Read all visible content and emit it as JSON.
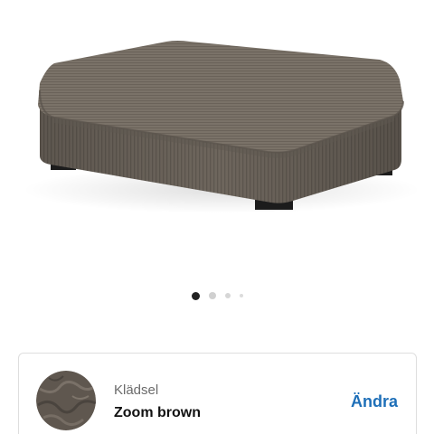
{
  "product": {
    "image_alt": "ottoman-footstool",
    "fabric_color": "#6e665d",
    "gallery": {
      "total_images": 4,
      "active_index": 0
    }
  },
  "upholstery": {
    "label": "Klädsel",
    "value": "Zoom brown",
    "change_label": "Ändra",
    "swatch_color": "#5f574f",
    "link_color": "#1e6fb8"
  }
}
